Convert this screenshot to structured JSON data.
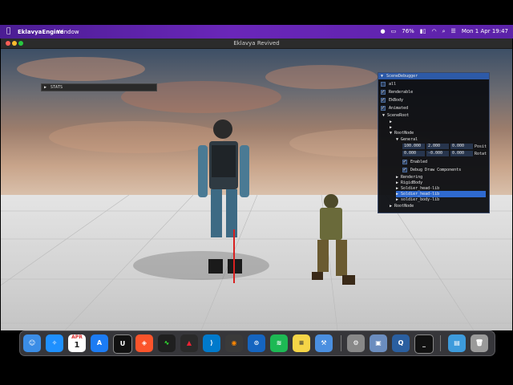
{
  "menubar": {
    "app_name": "EklavyaEngine",
    "menu_window": "Window",
    "battery": "76%",
    "datetime": "Mon 1 Apr  19:47"
  },
  "window": {
    "title": "Eklavya Revived"
  },
  "stats": {
    "label": "STATS"
  },
  "scene_debugger": {
    "title": "SceneDebugger",
    "filters": [
      {
        "label": "all",
        "checked": false
      },
      {
        "label": "Renderable",
        "checked": true
      },
      {
        "label": "EkBody",
        "checked": true
      },
      {
        "label": "Animated",
        "checked": true
      }
    ],
    "scene_root": "SceneRoot",
    "root_node": "RootNode",
    "general": "General",
    "position_values": [
      "100.000",
      "2.000",
      "0.000"
    ],
    "position_label": "Posit",
    "rotation_values": [
      "0.000",
      "-0.000",
      "0.000"
    ],
    "rotation_label": "Rotat",
    "enabled_label": "Enabled",
    "debug_draw_label": "Debug Draw Components",
    "rendering": "Rendering",
    "rigidbody": "RigidBody",
    "soldier_head_1": "Soldier_head-lib",
    "soldier_head_2": "Soldier_head-lib",
    "soldier_body": "soldier_body-lib",
    "root_node_2": "RootNode"
  },
  "calendar": {
    "month": "APR",
    "day": "1"
  }
}
